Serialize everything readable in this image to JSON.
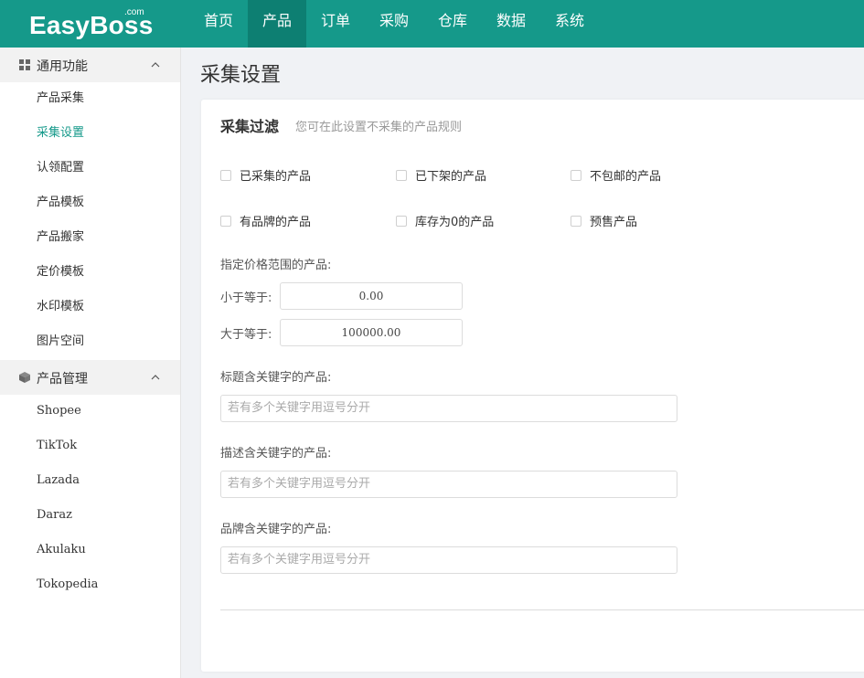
{
  "header": {
    "logo_text": "EasyBoss",
    "logo_suffix": ".com",
    "nav": [
      {
        "label": "首页"
      },
      {
        "label": "产品"
      },
      {
        "label": "订单"
      },
      {
        "label": "采购"
      },
      {
        "label": "仓库"
      },
      {
        "label": "数据"
      },
      {
        "label": "系统"
      }
    ],
    "active_nav": "产品"
  },
  "sidebar": {
    "groups": [
      {
        "label": "通用功能",
        "icon": "grid-icon",
        "items": [
          "产品采集",
          "采集设置",
          "认领配置",
          "产品模板",
          "产品搬家",
          "定价模板",
          "水印模板",
          "图片空间"
        ]
      },
      {
        "label": "产品管理",
        "icon": "box-icon",
        "items": [
          "Shopee",
          "TikTok",
          "Lazada",
          "Daraz",
          "Akulaku",
          "Tokopedia"
        ]
      }
    ],
    "active_item": "采集设置"
  },
  "main": {
    "page_title": "采集设置",
    "section_title": "采集过滤",
    "section_subtitle": "您可在此设置不采集的产品规则",
    "checkboxes": [
      {
        "label": "已采集的产品",
        "checked": false
      },
      {
        "label": "已下架的产品",
        "checked": false
      },
      {
        "label": "不包邮的产品",
        "checked": false
      },
      {
        "label": "有品牌的产品",
        "checked": false
      },
      {
        "label": "库存为0的产品",
        "checked": false
      },
      {
        "label": "预售产品",
        "checked": false
      }
    ],
    "price_range": {
      "label": "指定价格范围的产品:",
      "max_label": "小于等于:",
      "max_value": "0.00",
      "min_label": "大于等于:",
      "min_value": "100000.00"
    },
    "title_keywords": {
      "label": "标题含关键字的产品:",
      "placeholder": "若有多个关键字用逗号分开",
      "value": ""
    },
    "desc_keywords": {
      "label": "描述含关键字的产品:",
      "placeholder": "若有多个关键字用逗号分开",
      "value": ""
    },
    "brand_keywords": {
      "label": "品牌含关键字的产品:",
      "placeholder": "若有多个关键字用逗号分开",
      "value": ""
    }
  },
  "colors": {
    "brand": "#15998a",
    "nav_active": "#0d7f72"
  }
}
